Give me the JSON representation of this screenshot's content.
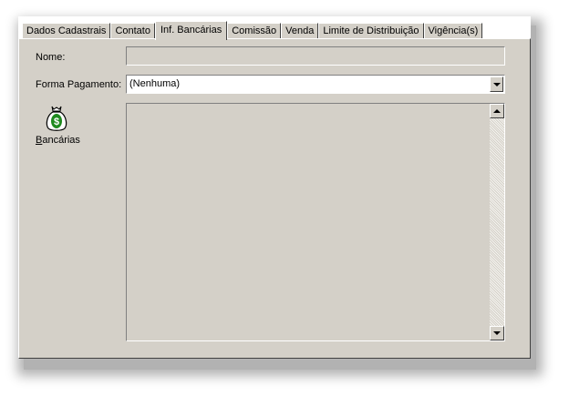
{
  "tabs": [
    {
      "label": "Dados Cadastrais",
      "active": false
    },
    {
      "label": "Contato",
      "active": false
    },
    {
      "label": "Inf. Bancárias",
      "active": true
    },
    {
      "label": "Comissão",
      "active": false
    },
    {
      "label": "Venda",
      "active": false
    },
    {
      "label": "Limite de Distribuição",
      "active": false
    },
    {
      "label": "Vigência(s)",
      "active": false
    }
  ],
  "form": {
    "name_label": "Nome:",
    "name_value": "",
    "payment_label": "Forma Pagamento:",
    "payment_value": "(Nenhuma)"
  },
  "sidebar": {
    "icon": "money-bag-icon",
    "caption_underlined": "B",
    "caption_rest": "ancárias"
  },
  "colors": {
    "face": "#d4d0c8",
    "icon_green": "#1f8a1f"
  }
}
